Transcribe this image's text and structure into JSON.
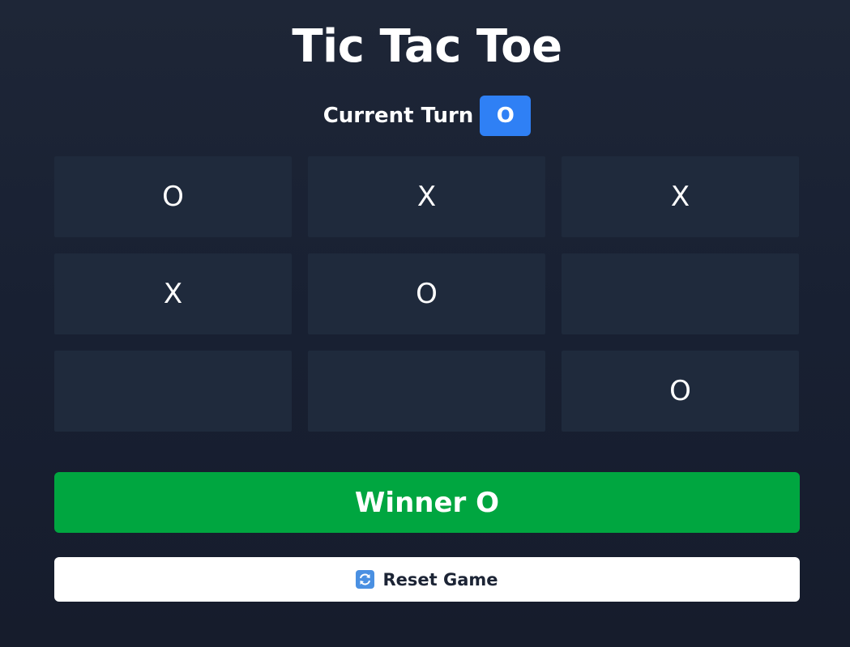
{
  "header": {
    "title": "Tic Tac Toe"
  },
  "turn": {
    "label": "Current Turn",
    "player": "O",
    "badge_color": "#2f80f5"
  },
  "board": {
    "cells": [
      "O",
      "X",
      "X",
      "X",
      "O",
      "",
      "",
      "",
      "O"
    ]
  },
  "status": {
    "text": "Winner O",
    "color": "#00a640"
  },
  "reset": {
    "label": "Reset Game",
    "icon": "refresh-icon"
  },
  "theme": {
    "background": "#1b2233",
    "cell_background": "#1f2a3c"
  }
}
